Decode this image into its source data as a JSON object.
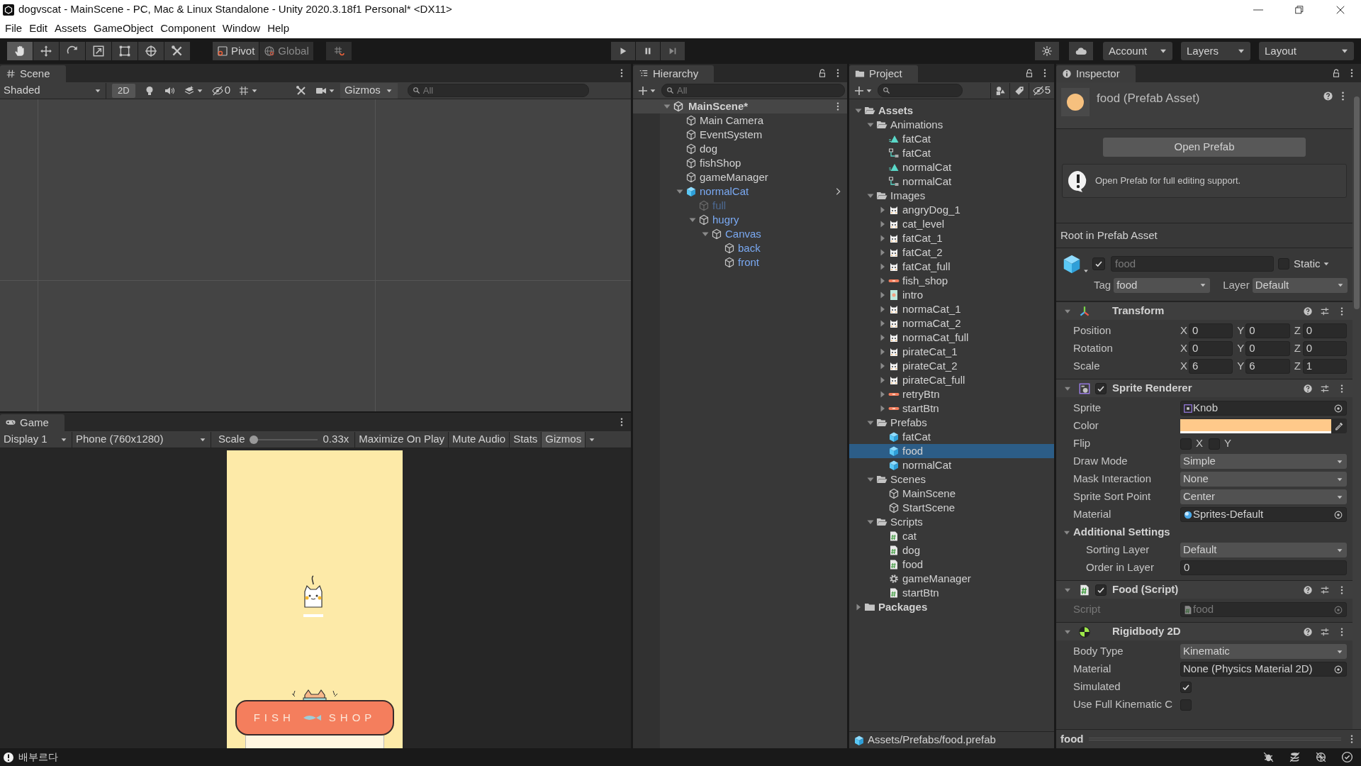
{
  "window": {
    "title": "dogvscat - MainScene - PC, Mac & Linux Standalone - Unity 2020.3.18f1 Personal* <DX11>"
  },
  "menu": [
    "File",
    "Edit",
    "Assets",
    "GameObject",
    "Component",
    "Window",
    "Help"
  ],
  "toolbar": {
    "tools": [
      {
        "kind": "hand",
        "selected": true
      },
      {
        "kind": "move",
        "selected": false
      },
      {
        "kind": "rotate",
        "selected": false
      },
      {
        "kind": "scale",
        "selected": false
      },
      {
        "kind": "rect",
        "selected": false
      },
      {
        "kind": "transform",
        "selected": false
      },
      {
        "kind": "custom",
        "selected": false
      }
    ],
    "pivot": "Pivot",
    "global": "Global",
    "account": "Account",
    "layers": "Layers",
    "layout": "Layout"
  },
  "scene": {
    "tab": "Scene",
    "shading": "Shaded",
    "mode_2d": "2D",
    "hidden_count": "0",
    "gizmos": "Gizmos",
    "search": {
      "placeholder": "All"
    }
  },
  "game": {
    "tab": "Game",
    "display": "Display 1",
    "resolution": "Phone (760x1280)",
    "scale_label": "Scale",
    "scale": {
      "level": 0
    },
    "scale_value": "0.33x",
    "buttons": [
      {
        "label": "Maximize On Play",
        "on": false
      },
      {
        "label": "Mute Audio",
        "on": false
      },
      {
        "label": "Stats",
        "on": false
      },
      {
        "label": "Gizmos",
        "on": true
      }
    ],
    "sign": [
      "FISH",
      "SHOP"
    ]
  },
  "hierarchy": {
    "tab": "Hierarchy",
    "search": {
      "placeholder": "All"
    },
    "scene": {
      "label": "MainScene*",
      "expanded": true
    },
    "items": [
      {
        "label": "Main Camera",
        "kind": "object",
        "active": true,
        "selected": false
      },
      {
        "label": "EventSystem",
        "kind": "object",
        "active": true,
        "selected": false
      },
      {
        "label": "dog",
        "kind": "object",
        "active": true,
        "selected": false
      },
      {
        "label": "fishShop",
        "kind": "object",
        "active": true,
        "selected": false
      },
      {
        "label": "gameManager",
        "kind": "object",
        "active": true,
        "selected": false
      },
      {
        "label": "normalCat",
        "kind": "prefab_root",
        "active": true,
        "selected": false,
        "expanded": true,
        "children": [
          {
            "label": "full",
            "kind": "prefab_child",
            "active": false,
            "selected": false
          },
          {
            "label": "hugry",
            "kind": "prefab_child",
            "active": true,
            "selected": false,
            "expanded": true,
            "children": [
              {
                "label": "Canvas",
                "kind": "prefab_child",
                "active": true,
                "selected": false,
                "expanded": true,
                "children": [
                  {
                    "label": "back",
                    "kind": "prefab_child",
                    "active": true,
                    "selected": false
                  },
                  {
                    "label": "front",
                    "kind": "prefab_child",
                    "active": true,
                    "selected": false
                  }
                ]
              }
            ]
          }
        ]
      }
    ]
  },
  "project": {
    "tab": "Project",
    "hidden_count": "5",
    "path": "Assets/Prefabs/food.prefab",
    "tree": [
      {
        "label": "Assets",
        "kind": "folder",
        "expanded": true,
        "selected": false,
        "children": [
          {
            "label": "Animations",
            "kind": "folder",
            "expanded": true,
            "selected": false,
            "children": [
              {
                "label": "fatCat",
                "kind": "anim",
                "selected": false
              },
              {
                "label": "fatCat",
                "kind": "animator",
                "selected": false
              },
              {
                "label": "normalCat",
                "kind": "anim",
                "selected": false
              },
              {
                "label": "normalCat",
                "kind": "animator",
                "selected": false
              }
            ]
          },
          {
            "label": "Images",
            "kind": "folder",
            "expanded": true,
            "selected": false,
            "children": [
              {
                "label": "angryDog_1",
                "kind": "sprite",
                "expanded": false,
                "selected": false
              },
              {
                "label": "cat_level",
                "kind": "sprite",
                "expanded": false,
                "selected": false
              },
              {
                "label": "fatCat_1",
                "kind": "sprite",
                "expanded": false,
                "selected": false
              },
              {
                "label": "fatCat_2",
                "kind": "sprite",
                "expanded": false,
                "selected": false
              },
              {
                "label": "fatCat_full",
                "kind": "sprite",
                "expanded": false,
                "selected": false
              },
              {
                "label": "fish_shop",
                "kind": "banner",
                "expanded": false,
                "selected": false
              },
              {
                "label": "intro",
                "kind": "picture",
                "expanded": false,
                "selected": false
              },
              {
                "label": "normaCat_1",
                "kind": "sprite",
                "expanded": false,
                "selected": false
              },
              {
                "label": "normaCat_2",
                "kind": "sprite",
                "expanded": false,
                "selected": false
              },
              {
                "label": "normaCat_full",
                "kind": "sprite",
                "expanded": false,
                "selected": false
              },
              {
                "label": "pirateCat_1",
                "kind": "sprite",
                "expanded": false,
                "selected": false
              },
              {
                "label": "pirateCat_2",
                "kind": "sprite",
                "expanded": false,
                "selected": false
              },
              {
                "label": "pirateCat_full",
                "kind": "sprite",
                "expanded": false,
                "selected": false
              },
              {
                "label": "retryBtn",
                "kind": "banner",
                "expanded": false,
                "selected": false
              },
              {
                "label": "startBtn",
                "kind": "banner",
                "expanded": false,
                "selected": false
              }
            ]
          },
          {
            "label": "Prefabs",
            "kind": "folder",
            "expanded": true,
            "selected": false,
            "children": [
              {
                "label": "fatCat",
                "kind": "prefab",
                "selected": false
              },
              {
                "label": "food",
                "kind": "prefab",
                "selected": true
              },
              {
                "label": "normalCat",
                "kind": "prefab",
                "selected": false
              }
            ]
          },
          {
            "label": "Scenes",
            "kind": "folder",
            "expanded": true,
            "selected": false,
            "children": [
              {
                "label": "MainScene",
                "kind": "scene",
                "selected": false
              },
              {
                "label": "StartScene",
                "kind": "scene",
                "selected": false
              }
            ]
          },
          {
            "label": "Scripts",
            "kind": "folder",
            "expanded": true,
            "selected": false,
            "children": [
              {
                "label": "cat",
                "kind": "script",
                "selected": false
              },
              {
                "label": "dog",
                "kind": "script",
                "selected": false
              },
              {
                "label": "food",
                "kind": "script",
                "selected": false
              },
              {
                "label": "gameManager",
                "kind": "script_gear",
                "selected": false
              },
              {
                "label": "startBtn",
                "kind": "script",
                "selected": false
              }
            ]
          }
        ]
      },
      {
        "label": "Packages",
        "kind": "folder",
        "expanded": false,
        "selected": false
      }
    ]
  },
  "inspector": {
    "tab": "Inspector",
    "title": "food (Prefab Asset)",
    "open_button": "Open Prefab",
    "help": "Open Prefab for full editing support.",
    "root_label": "Root in Prefab Asset",
    "object": {
      "active": true,
      "name": "food",
      "static": false,
      "static_label": "Static",
      "tag_label": "Tag",
      "tag": "food",
      "layer_label": "Layer",
      "layer": "Default"
    },
    "components": [
      {
        "kind": "transform",
        "title": "Transform",
        "expanded": true,
        "rows": [
          {
            "kind": "vector",
            "label": "Position",
            "values": [
              {
                "axis": "X",
                "value": "0"
              },
              {
                "axis": "Y",
                "value": "0"
              },
              {
                "axis": "Z",
                "value": "0"
              }
            ]
          },
          {
            "kind": "vector",
            "label": "Rotation",
            "values": [
              {
                "axis": "X",
                "value": "0"
              },
              {
                "axis": "Y",
                "value": "0"
              },
              {
                "axis": "Z",
                "value": "0"
              }
            ]
          },
          {
            "kind": "vector",
            "label": "Scale",
            "values": [
              {
                "axis": "X",
                "value": "6"
              },
              {
                "axis": "Y",
                "value": "6"
              },
              {
                "axis": "Z",
                "value": "1"
              }
            ]
          }
        ]
      },
      {
        "kind": "sprite_renderer",
        "title": "Sprite Renderer",
        "enabled": true,
        "expanded": true,
        "rows": [
          {
            "kind": "object",
            "label": "Sprite",
            "value": "Knob"
          },
          {
            "kind": "color",
            "label": "Color",
            "color": "#ffc98a"
          },
          {
            "kind": "flip",
            "label": "Flip",
            "options": [
              {
                "label": "X",
                "checked": false
              },
              {
                "label": "Y",
                "checked": false
              }
            ]
          },
          {
            "kind": "dropdown",
            "label": "Draw Mode",
            "value": "Simple"
          },
          {
            "kind": "dropdown",
            "label": "Mask Interaction",
            "value": "None"
          },
          {
            "kind": "dropdown",
            "label": "Sprite Sort Point",
            "value": "Center"
          },
          {
            "kind": "object",
            "label": "Material",
            "value": "Sprites-Default"
          },
          {
            "kind": "section",
            "label": "Additional Settings",
            "expanded": true,
            "rows": [
              {
                "kind": "dropdown",
                "label": "Sorting Layer",
                "value": "Default"
              },
              {
                "kind": "number",
                "label": "Order in Layer",
                "value": "0"
              }
            ]
          }
        ]
      },
      {
        "kind": "script",
        "title": "Food (Script)",
        "enabled": true,
        "expanded": true,
        "rows": [
          {
            "kind": "object",
            "label": "Script",
            "value": "food",
            "disabled": true
          }
        ]
      },
      {
        "kind": "rigidbody",
        "title": "Rigidbody 2D",
        "expanded": true,
        "rows": [
          {
            "kind": "dropdown",
            "label": "Body Type",
            "value": "Kinematic"
          },
          {
            "kind": "object",
            "label": "Material",
            "value": "None (Physics Material 2D)"
          },
          {
            "kind": "checkbox",
            "label": "Simulated",
            "checked": true
          },
          {
            "kind": "checkbox",
            "label": "Use Full Kinematic C",
            "checked": false
          }
        ]
      }
    ],
    "preview_label": "food"
  },
  "status_bar": {
    "message": "배부르다"
  }
}
